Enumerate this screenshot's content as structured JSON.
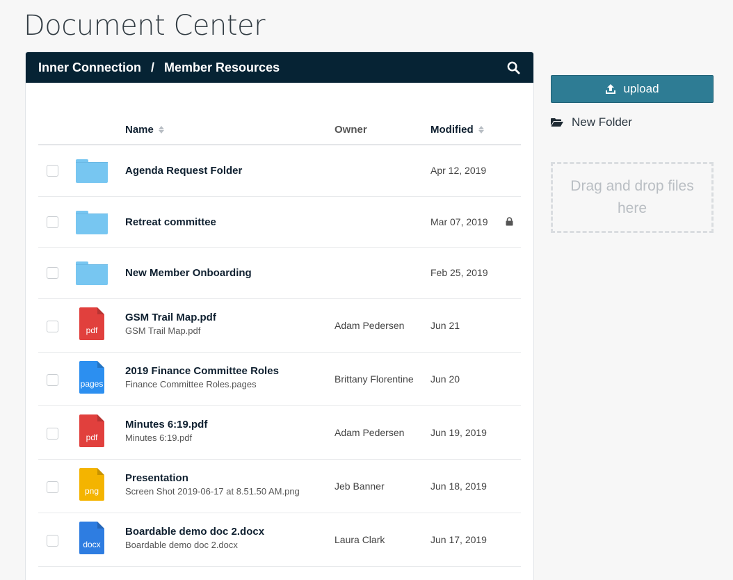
{
  "page_title": "Document Center",
  "breadcrumb": [
    "Inner Connection",
    "Member Resources"
  ],
  "breadcrumb_separator": "/",
  "columns": {
    "name": "Name",
    "owner": "Owner",
    "modified": "Modified"
  },
  "rows": [
    {
      "kind": "folder",
      "name": "Agenda Request Folder",
      "subname": "",
      "owner": "",
      "modified": "Apr 12, 2019",
      "locked": false
    },
    {
      "kind": "folder",
      "name": "Retreat committee",
      "subname": "",
      "owner": "",
      "modified": "Mar 07, 2019",
      "locked": true
    },
    {
      "kind": "folder",
      "name": "New Member Onboarding",
      "subname": "",
      "owner": "",
      "modified": "Feb 25, 2019",
      "locked": false
    },
    {
      "kind": "file",
      "type": "pdf",
      "name": "GSM Trail Map.pdf",
      "subname": "GSM Trail Map.pdf",
      "owner": "Adam Pedersen",
      "modified": "Jun 21"
    },
    {
      "kind": "file",
      "type": "pages",
      "name": "2019 Finance Committee Roles",
      "subname": "Finance Committee Roles.pages",
      "owner": "Brittany Florentine",
      "modified": "Jun 20"
    },
    {
      "kind": "file",
      "type": "pdf",
      "name": "Minutes 6:19.pdf",
      "subname": "Minutes 6:19.pdf",
      "owner": "Adam Pedersen",
      "modified": "Jun 19, 2019"
    },
    {
      "kind": "file",
      "type": "png",
      "name": "Presentation",
      "subname": "Screen Shot 2019-06-17 at 8.51.50 AM.png",
      "owner": "Jeb Banner",
      "modified": "Jun 18, 2019"
    },
    {
      "kind": "file",
      "type": "docx",
      "name": "Boardable demo doc 2.docx",
      "subname": "Boardable demo doc 2.docx",
      "owner": "Laura Clark",
      "modified": "Jun 17, 2019"
    }
  ],
  "sidebar": {
    "upload_label": "upload",
    "new_folder_label": "New Folder",
    "dropzone_text": "Drag and drop files here"
  },
  "icons": {
    "search": "search-icon",
    "upload": "upload-icon",
    "new_folder": "folder-open-icon",
    "lock": "lock-icon",
    "sort": "sort-icon"
  },
  "colors": {
    "header_bg": "#062334",
    "upload_bg": "#2e7c94",
    "folder": "#77c6f1",
    "pdf": "#e1403d",
    "pages": "#2c8ff0",
    "png": "#f4b400",
    "docx": "#2e7de1"
  }
}
